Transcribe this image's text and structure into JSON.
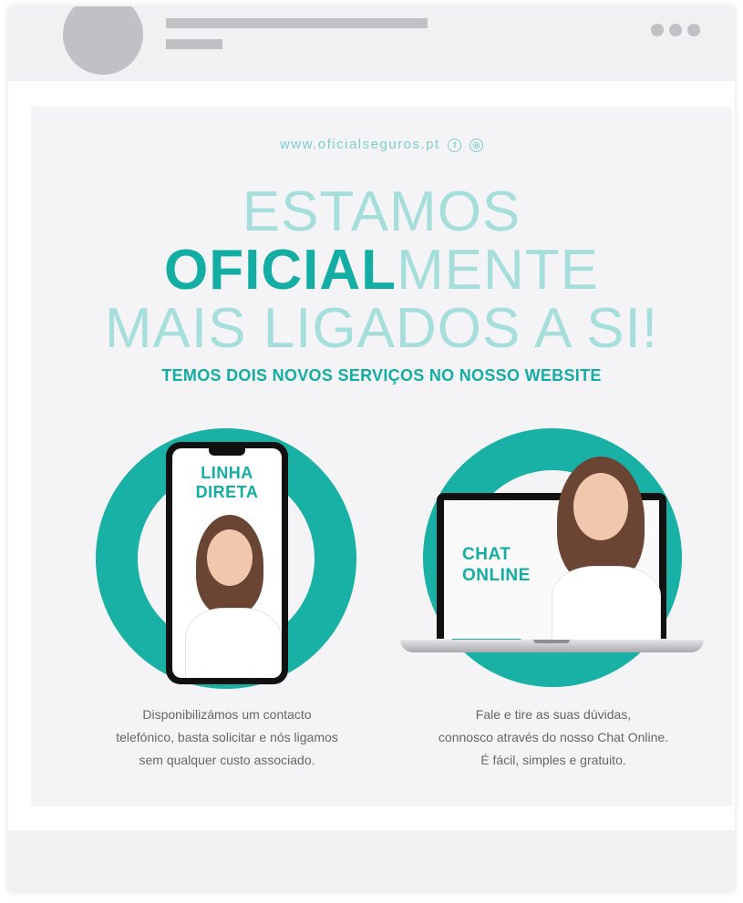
{
  "ad": {
    "url": "www.oficialseguros.pt",
    "social_icons": [
      "facebook-icon",
      "instagram-icon"
    ],
    "headline": {
      "line1": "ESTAMOS",
      "line2_strong": "OFICIAL",
      "line2_light": "MENTE",
      "line3": "MAIS LIGADOS A SI!"
    },
    "subheadline": "TEMOS DOIS NOVOS SERVIÇOS NO NOSSO WEBSITE",
    "services": [
      {
        "title_line1": "LINHA",
        "title_line2": "DIRETA",
        "desc_line1": "Disponibilizámos um contacto",
        "desc_line2": "telefónico, basta solicitar e nós ligamos",
        "desc_line3": "sem qualquer custo associado."
      },
      {
        "title_line1": "CHAT",
        "title_line2": "ONLINE",
        "desc_line1": "Fale e tire as suas dúvidas,",
        "desc_line2": "connosco através do nosso Chat Online.",
        "desc_line3": "É fácil, simples e gratuito."
      }
    ]
  },
  "colors": {
    "accent": "#13ada3",
    "accent_light": "#a6dedb",
    "ring": "#19b0a5",
    "placeholder_gray": "#c1c1c5"
  }
}
